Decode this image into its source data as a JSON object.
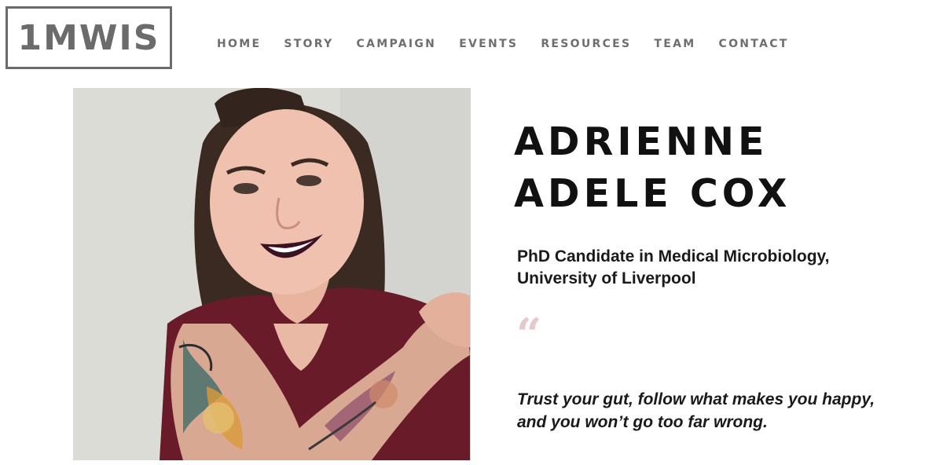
{
  "header": {
    "logo_text": "1MWIS",
    "nav": [
      "HOME",
      "STORY",
      "CAMPAIGN",
      "EVENTS",
      "RESOURCES",
      "TEAM",
      "CONTACT"
    ]
  },
  "profile": {
    "name": "ADRIENNE ADELE COX",
    "role_line1": "PhD Candidate in Medical Microbiology,",
    "role_line2": "University of Liverpool",
    "quote_mark": "“",
    "quote_line1": "Trust your gut, follow what makes you happy,",
    "quote_line2": "and you won’t go too far wrong.",
    "photo_icon": "portrait-photo"
  },
  "colors": {
    "logo": "#6b6b6b",
    "nav_text": "#6e6e6e",
    "name_text": "#111111",
    "quote_mark": "#e8c9cb"
  }
}
